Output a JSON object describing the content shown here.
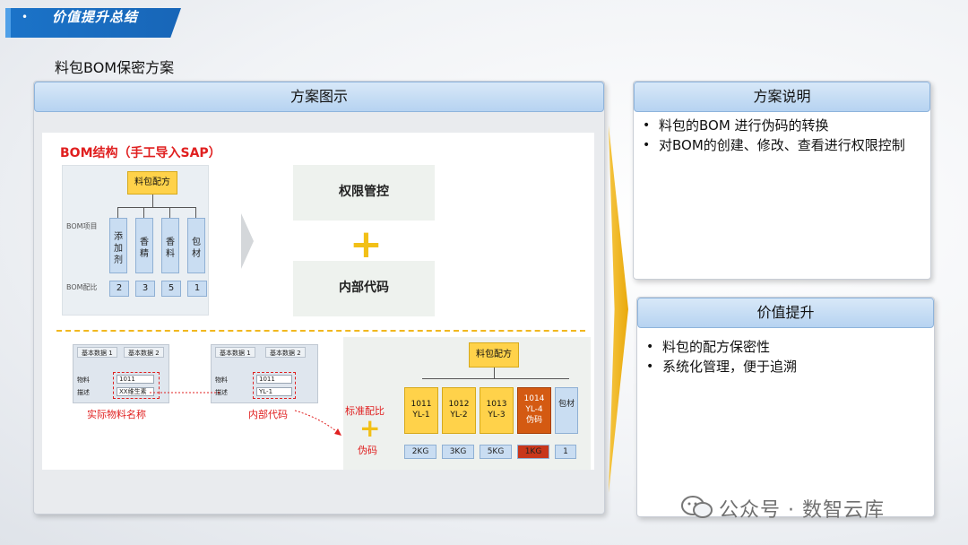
{
  "header": {
    "title": "价值提升总结",
    "bullet": "•"
  },
  "subtitle": "料包BOM保密方案",
  "left_panel": {
    "title": "方案图示",
    "bom_title": "BOM结构（手工导入SAP）",
    "root_label": "料包配方",
    "row_label_items": "BOM项目",
    "row_label_ratio": "BOM配比",
    "items": [
      "添加剂",
      "香精",
      "香料",
      "包材"
    ],
    "ratios": [
      "2",
      "3",
      "5",
      "1"
    ],
    "control_top": "权限管控",
    "control_bottom": "内部代码",
    "sap_left": {
      "tab1": "基本数据 1",
      "tab2": "基本数据 2",
      "row1_label": "物料",
      "row1_value": "1011",
      "row2_label": "描述",
      "row2_value": "XX维生素"
    },
    "sap_right": {
      "tab1": "基本数据 1",
      "tab2": "基本数据 2",
      "row1_label": "物料",
      "row1_value": "1011",
      "row2_label": "描述",
      "row2_value": "YL-1"
    },
    "caption_actual": "实际物料名称",
    "caption_internal": "内部代码",
    "caption_standard": "标准配比",
    "caption_pseudo": "伪码",
    "tree_root": "料包配方",
    "tree_items": [
      {
        "code": "1011",
        "name": "YL-1"
      },
      {
        "code": "1012",
        "name": "YL-2"
      },
      {
        "code": "1013",
        "name": "YL-3"
      },
      {
        "code": "1014",
        "name": "YL-4",
        "extra": "伪码"
      },
      {
        "code": "",
        "name": "包材"
      }
    ],
    "tree_ratios": [
      "2KG",
      "3KG",
      "5KG",
      "1KG",
      "1"
    ]
  },
  "right_top": {
    "title": "方案说明",
    "bullets": [
      "料包的BOM 进行伪码的转换",
      "对BOM的创建、修改、查看进行权限控制"
    ]
  },
  "right_bottom": {
    "title": "价值提升",
    "bullets": [
      "料包的配方保密性",
      "系统化管理，便于追溯"
    ]
  },
  "watermark": "公众号 · 数智云库",
  "colors": {
    "accent_blue": "#1b73c8",
    "header_blue": "#b6d3f1",
    "yellow": "#ffd24a",
    "red": "#e02020",
    "orange": "#d45a12"
  }
}
